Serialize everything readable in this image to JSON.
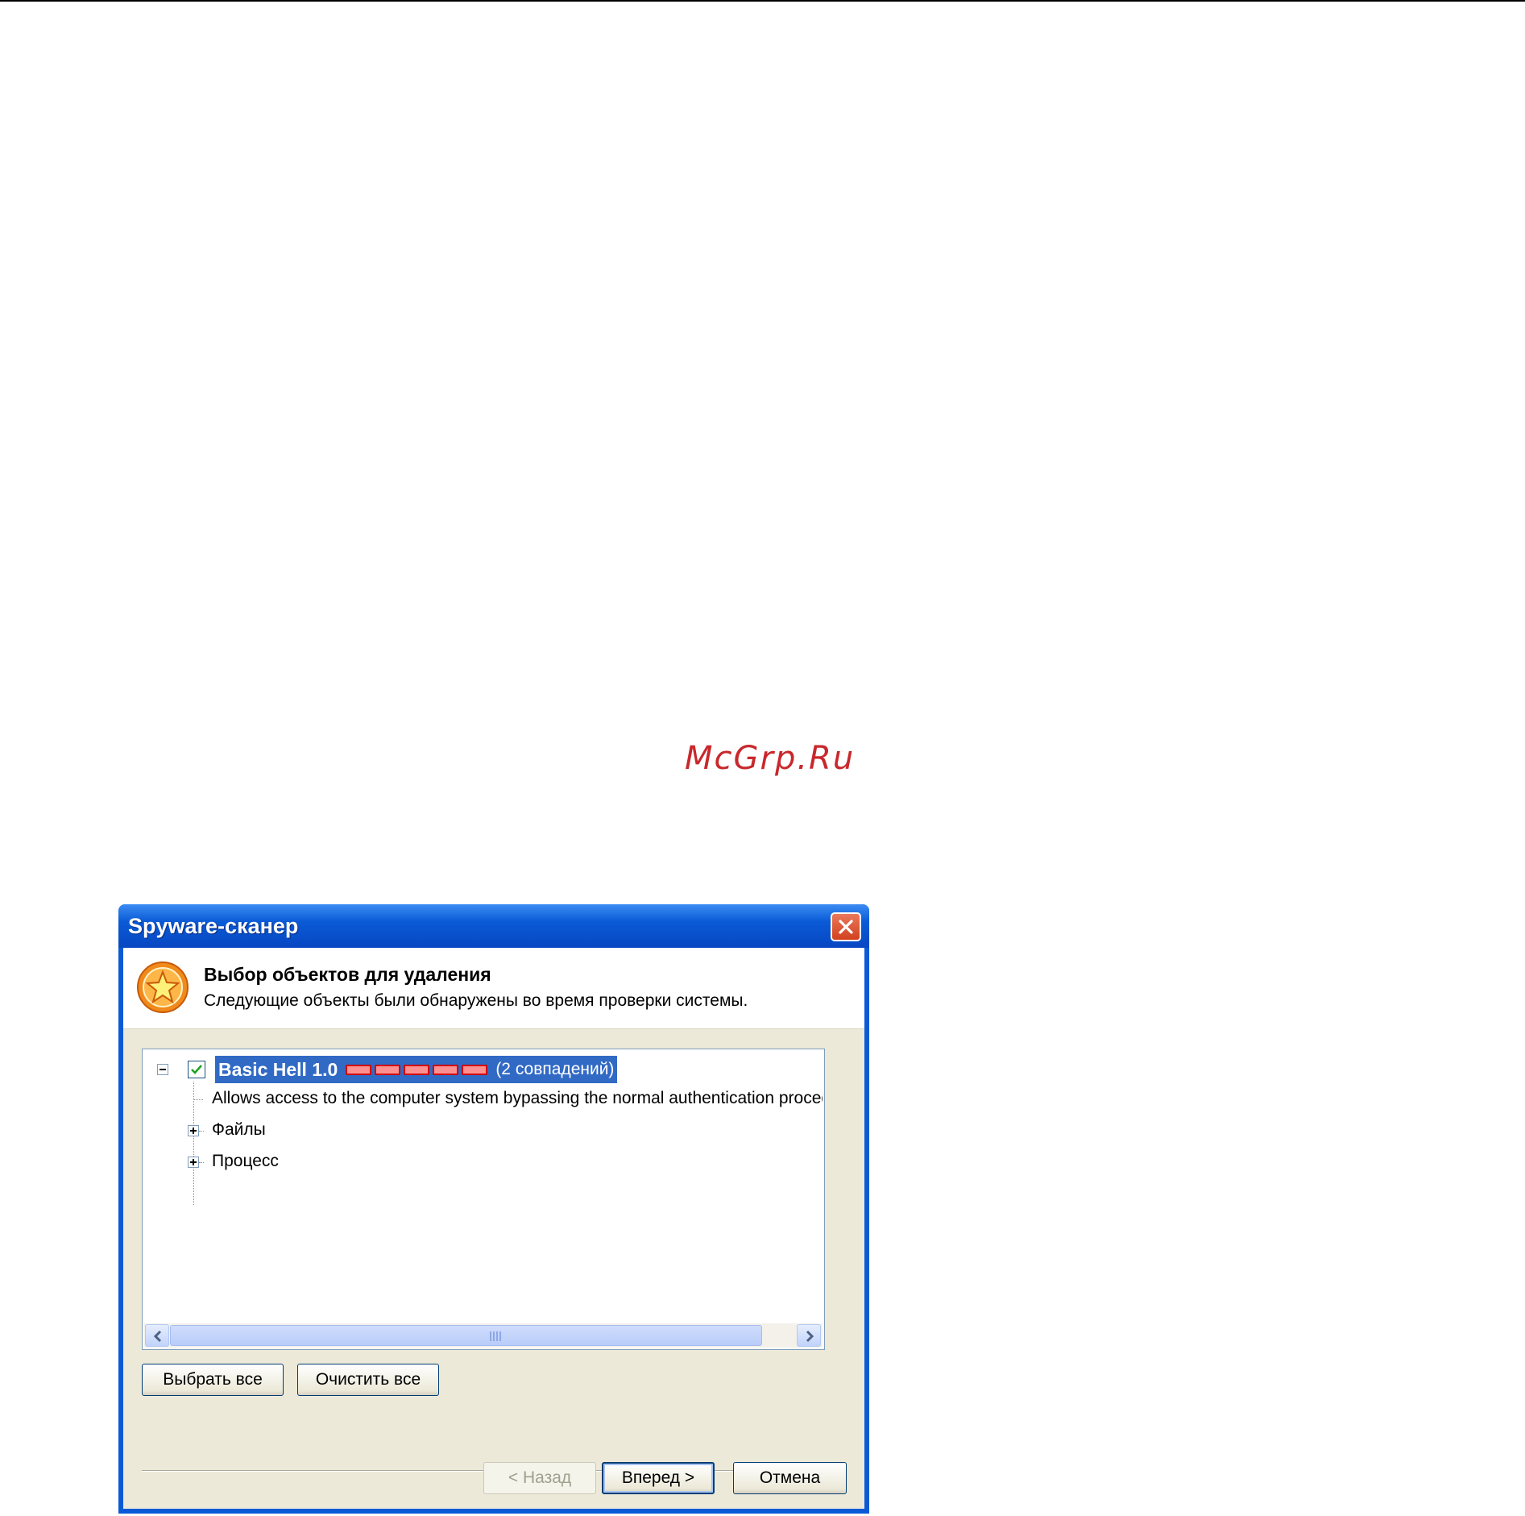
{
  "watermark": "McGrp.Ru",
  "window": {
    "title": "Spyware-сканер"
  },
  "header": {
    "title": "Выбор объектов для удаления",
    "subtitle": "Следующие объекты были обнаружены во время проверки системы."
  },
  "tree": {
    "root": {
      "name": "Basic Hell 1.0",
      "severity_level": 5,
      "matches": "(2 совпадений)",
      "checked": true,
      "expanded": true
    },
    "children": [
      {
        "label": "Allows access to the computer system bypassing the normal authentication procedu",
        "expandable": false
      },
      {
        "label": "Файлы",
        "expandable": true
      },
      {
        "label": "Процесс",
        "expandable": true
      }
    ]
  },
  "buttons": {
    "select_all": "Выбрать все",
    "clear_all": "Очистить все",
    "back": "< Назад",
    "next": "Вперед >",
    "cancel": "Отмена"
  },
  "colors": {
    "titlebar": "#0a5ad6",
    "selection": "#316ac5",
    "severity": "#ff9090",
    "watermark": "#c8282c"
  }
}
